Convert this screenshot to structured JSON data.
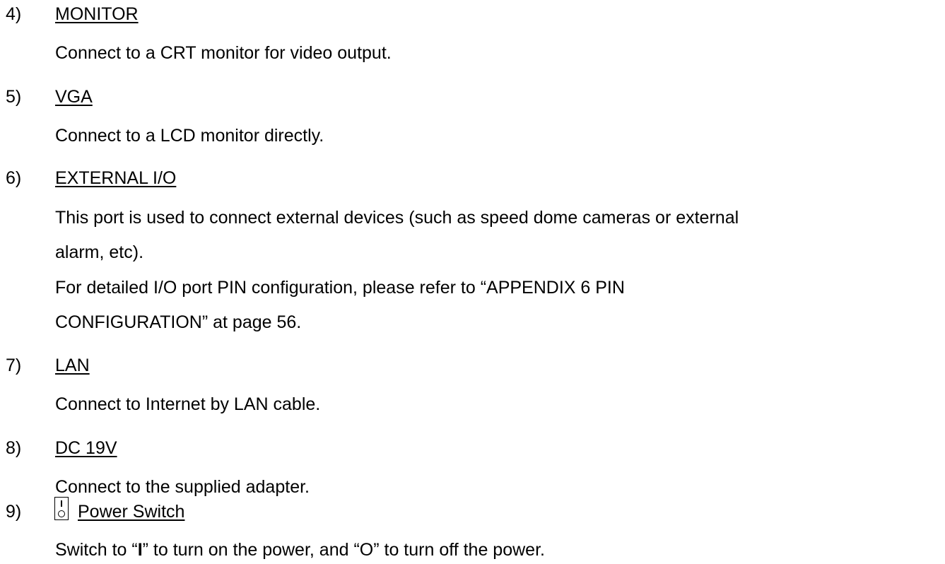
{
  "items": [
    {
      "number": "4)",
      "heading": "MONITOR",
      "lines": [
        "Connect to a CRT monitor for video output."
      ]
    },
    {
      "number": "5)",
      "heading": "VGA",
      "lines": [
        "Connect to a LCD monitor directly."
      ]
    },
    {
      "number": "6)",
      "heading": "EXTERNAL I/O",
      "lines": [
        "This port is used to connect external devices (such as speed dome cameras or external",
        "alarm, etc).",
        "For detailed I/O port PIN configuration, please refer to “APPENDIX 6 PIN",
        "CONFIGURATION” at page 56."
      ]
    },
    {
      "number": "7)",
      "heading": "LAN",
      "lines": [
        "Connect to Internet by LAN cable."
      ]
    },
    {
      "number": "8)",
      "heading": "DC 19V",
      "lines": [
        "Connect to the supplied adapter."
      ]
    },
    {
      "number": "9)",
      "heading": "Power Switch",
      "icon": "power-switch-icon",
      "text": {
        "before": "Switch to “",
        "on_symbol": "I",
        "after": "” to turn on the power, and “O” to turn off the power."
      }
    }
  ]
}
